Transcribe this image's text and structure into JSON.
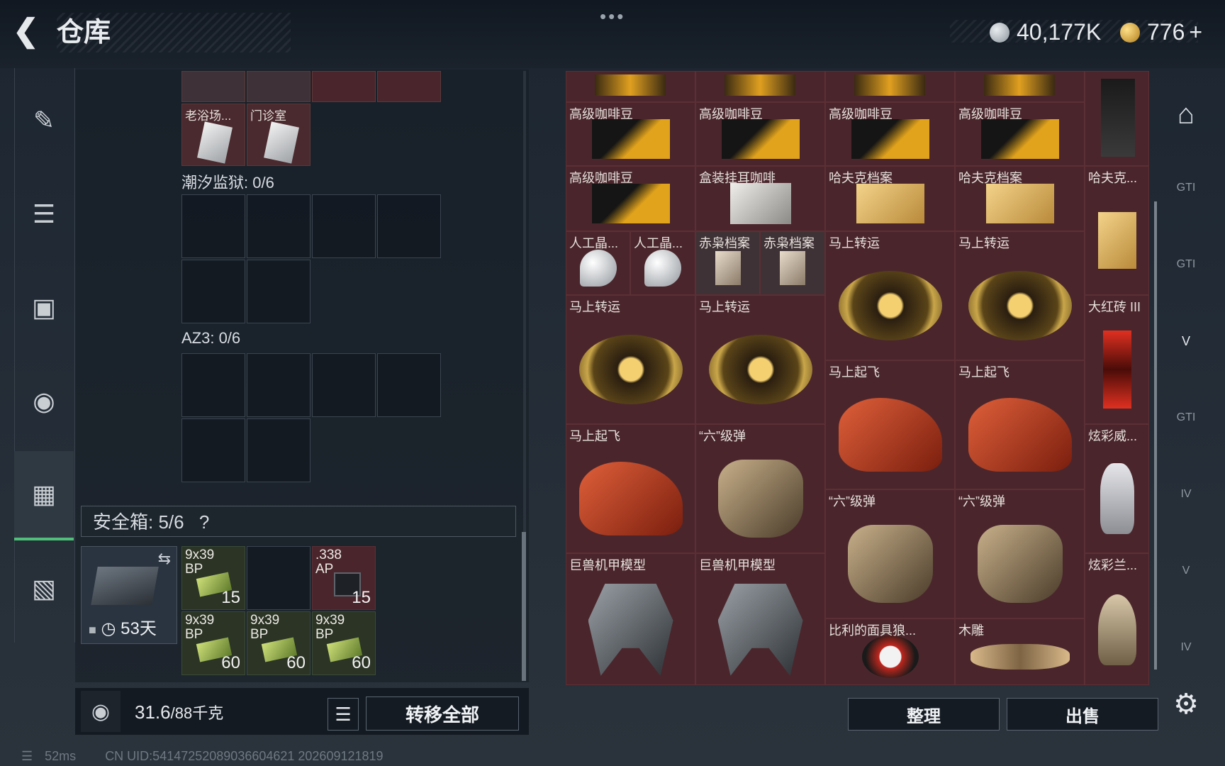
{
  "header": {
    "title": "仓库",
    "menu_dots": "•••",
    "currency_silver": "40,177K",
    "currency_gold": "776",
    "plus": "+"
  },
  "left_nav": [
    {
      "icon": "gun-icon"
    },
    {
      "icon": "armor-icon"
    },
    {
      "icon": "backpack-icon"
    },
    {
      "icon": "bag-icon"
    },
    {
      "icon": "safebox-icon",
      "active": true
    },
    {
      "icon": "briefcase-icon"
    }
  ],
  "mid": {
    "top_items": [
      {
        "label": "老浴场..."
      },
      {
        "label": "门诊室"
      }
    ],
    "section1": "潮汐监狱: 0/6",
    "section2": "AZ3: 0/6",
    "safebox_label": "安全箱: 5/6",
    "safebox_help": "?",
    "safebox_days": "53天",
    "ammo": [
      {
        "l1": "9x39",
        "l2": "BP",
        "count": "15"
      },
      {
        "l1": ".338",
        "l2": "AP",
        "count": "15"
      },
      {
        "l1": "9x39",
        "l2": "BP",
        "count": "60"
      },
      {
        "l1": "9x39",
        "l2": "BP",
        "count": "60"
      },
      {
        "l1": "9x39",
        "l2": "BP",
        "count": "60"
      }
    ],
    "weight_value": "31.6",
    "weight_cap": "/88千克",
    "transfer_all": "转移全部"
  },
  "right": {
    "items": [
      {
        "label": "高级咖啡豆"
      },
      {
        "label": "高级咖啡豆"
      },
      {
        "label": "高级咖啡豆"
      },
      {
        "label": "高级咖啡豆"
      },
      {
        "label": "高级咖啡豆"
      },
      {
        "label": "盒装挂耳咖啡"
      },
      {
        "label": "哈夫克档案"
      },
      {
        "label": "哈夫克档案"
      },
      {
        "label": "哈夫克..."
      },
      {
        "label": "人工晶..."
      },
      {
        "label": "人工晶..."
      },
      {
        "label": "赤枭档案"
      },
      {
        "label": "赤枭档案"
      },
      {
        "label": "马上转运"
      },
      {
        "label": "马上转运"
      },
      {
        "label": "马上转运"
      },
      {
        "label": "马上转运"
      },
      {
        "label": "大红砖 III"
      },
      {
        "label": "马上起飞"
      },
      {
        "label": "马上起飞"
      },
      {
        "label": "马上起飞"
      },
      {
        "label": "“六”级弹"
      },
      {
        "label": "炫彩威..."
      },
      {
        "label": "“六”级弹"
      },
      {
        "label": "“六”级弹"
      },
      {
        "label": "巨兽机甲模型"
      },
      {
        "label": "巨兽机甲模型"
      },
      {
        "label": "炫彩兰..."
      },
      {
        "label": "比利的面具狼..."
      },
      {
        "label": "木雕"
      }
    ],
    "sort_button": "整理",
    "sell_button": "出售"
  },
  "right_nav": [
    "GTI",
    "GTI",
    "V",
    "GTI",
    "IV",
    "V",
    "IV"
  ],
  "status": {
    "ping": "52ms",
    "uid": "CN UID:5414725208903660462​1 202609121819"
  },
  "colors": {
    "item_bg": "#4a262c",
    "accent_green": "#4fbf7a",
    "ammo_bg": "#2b3425"
  }
}
